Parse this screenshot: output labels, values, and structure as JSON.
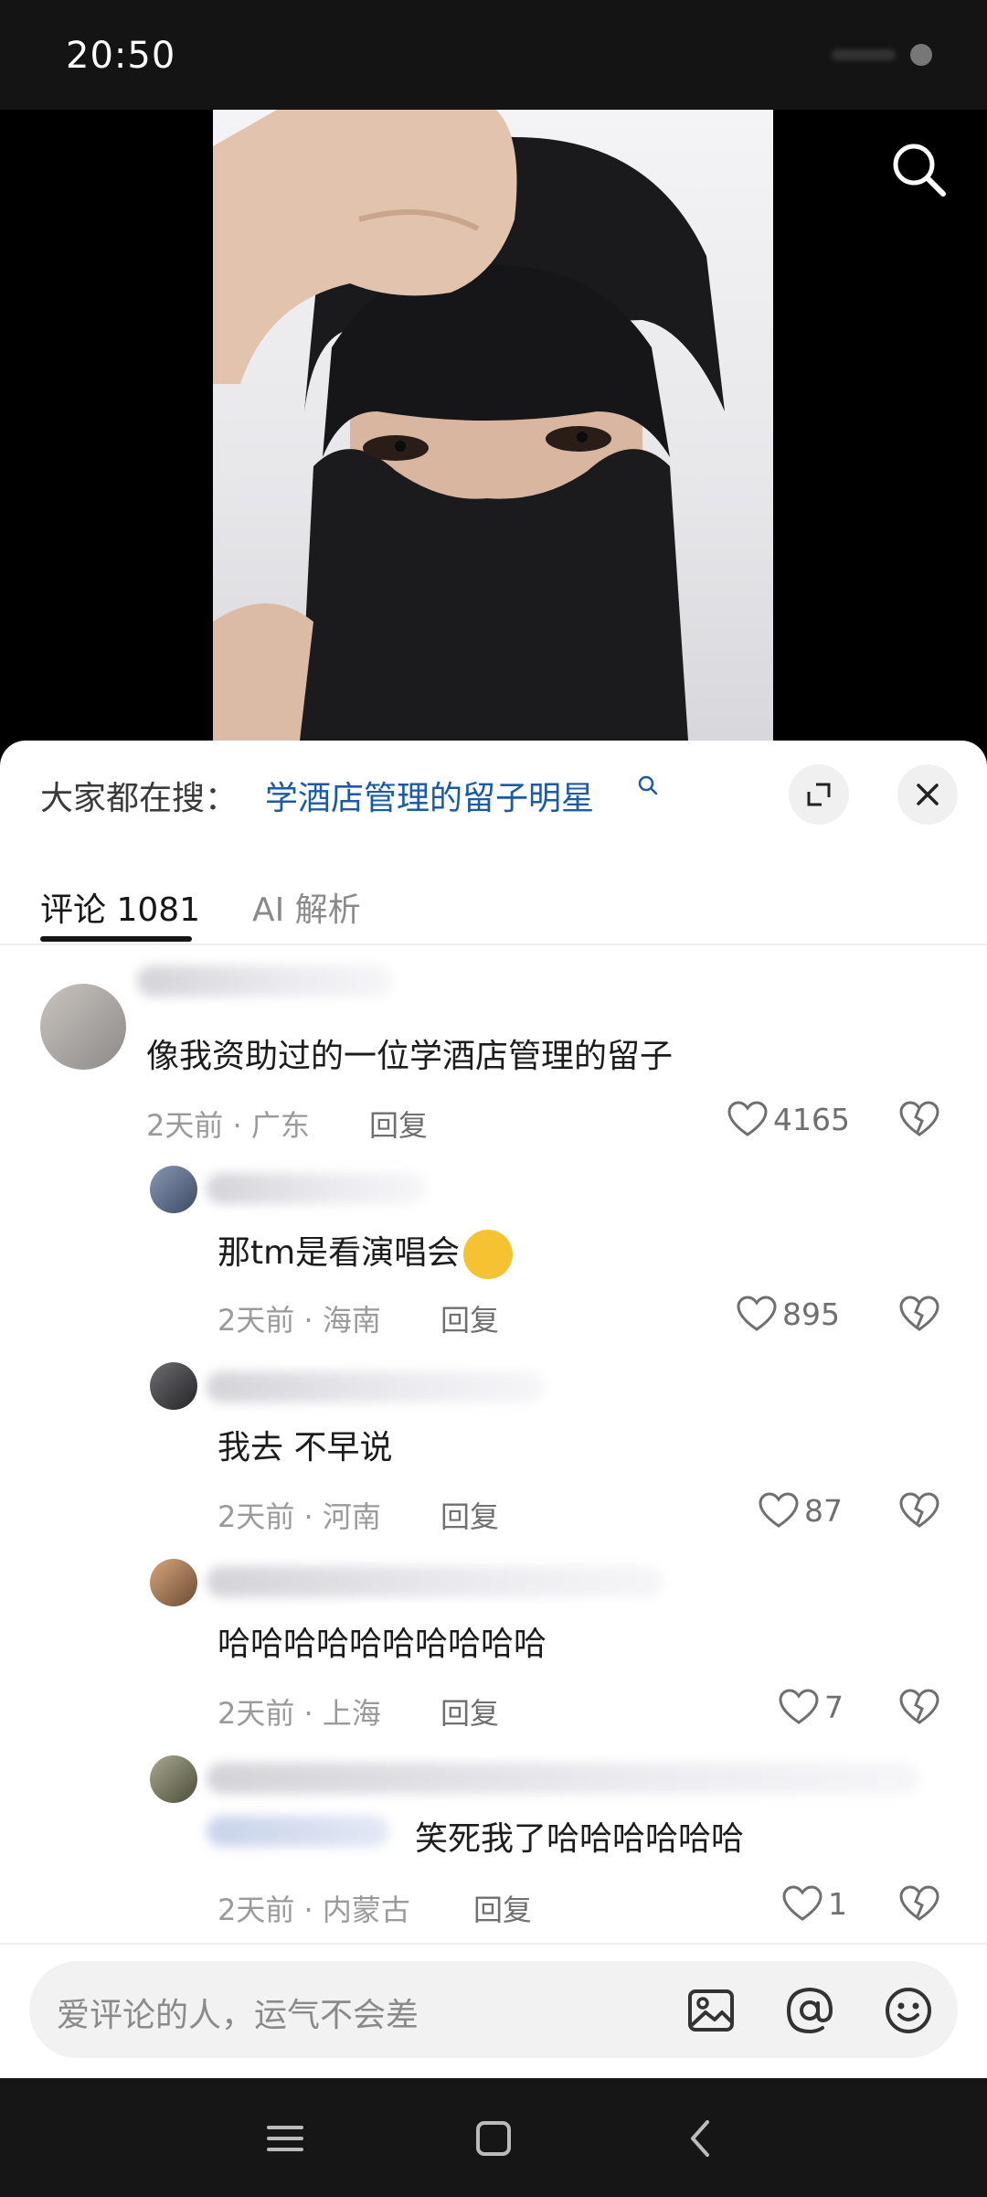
{
  "status_bar": {
    "time": "20:50"
  },
  "search_bar": {
    "prefix": "大家都在搜：",
    "query": "学酒店管理的留子明星"
  },
  "tabs": [
    {
      "label": "评论 1081",
      "active": true
    },
    {
      "label": "AI 解析",
      "active": false
    }
  ],
  "comments": [
    {
      "text": "像我资助过的一位学酒店管理的留子",
      "meta": "2天前 · 广东",
      "reply": "回复",
      "likes": "4165"
    },
    {
      "text": "那tm是看演唱会",
      "meta": "2天前 · 海南",
      "reply": "回复",
      "likes": "895"
    },
    {
      "text": "我去 不早说",
      "meta": "2天前 · 河南",
      "reply": "回复",
      "likes": "87"
    },
    {
      "text": "哈哈哈哈哈哈哈哈哈哈",
      "meta": "2天前 · 上海",
      "reply": "回复",
      "likes": "7"
    },
    {
      "text": "笑死我了哈哈哈哈哈哈",
      "meta": "2天前 · 内蒙古",
      "reply": "回复",
      "likes": "1"
    }
  ],
  "input": {
    "placeholder": "爱评论的人，运气不会差"
  },
  "icons": {
    "search": "search-icon",
    "expand": "expand-icon",
    "close": "close-icon",
    "like": "heart-icon",
    "dislike": "broken-heart-icon",
    "image": "image-icon",
    "mention": "at-icon",
    "emoji": "emoji-icon"
  },
  "colors": {
    "accent_link": "#1a5aa6",
    "text_primary": "#1c1c1c",
    "text_meta": "#9a9a9a"
  }
}
